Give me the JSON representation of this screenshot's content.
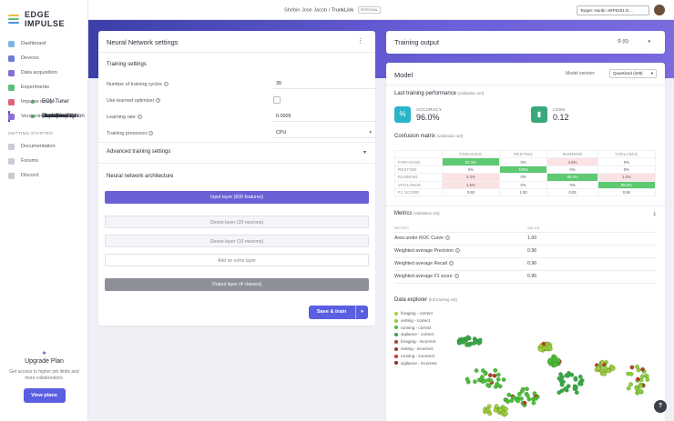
{
  "app": {
    "brand": "EDGE IMPULSE",
    "logo_colors": [
      "#e9c23c",
      "#5fbf7a",
      "#4a8fe2"
    ]
  },
  "header": {
    "user": "Shebin Jose Jacob",
    "separator": "/",
    "project": "TrunkLink",
    "badge": "PERSONAL",
    "target": "Target: Nordic nRF9151 D…"
  },
  "sidebar": {
    "items": [
      {
        "label": "Dashboard",
        "icon": "dashboard-icon",
        "color": "#7fb6e8"
      },
      {
        "label": "Devices",
        "icon": "devices-icon",
        "color": "#6b7fd6"
      },
      {
        "label": "Data acquisition",
        "icon": "database-icon",
        "color": "#8a6fd6"
      },
      {
        "label": "Experiments",
        "icon": "flask-icon",
        "color": "#5fbf7a"
      },
      {
        "label": "EON Tuner",
        "icon": "tuner-icon",
        "color": "#5fbf7a",
        "sub": true
      },
      {
        "label": "Impulse design",
        "icon": "impulse-icon",
        "color": "#e0637a",
        "chevron": "▾"
      },
      {
        "label": "Create impulse",
        "sub": true
      },
      {
        "label": "Raw data",
        "sub": true
      },
      {
        "label": "Classifier",
        "sub": true,
        "active": true
      },
      {
        "label": "Retrain model",
        "sub": true
      },
      {
        "label": "Live classification",
        "sub": true
      },
      {
        "label": "Model testing",
        "sub": true
      },
      {
        "label": "Deployment",
        "sub": true
      },
      {
        "label": "Versioning",
        "icon": "versioning-icon",
        "color": "#8a6fd6"
      }
    ],
    "section": "GETTING STARTED",
    "getting_started": [
      {
        "label": "Documentation",
        "icon": "book-icon"
      },
      {
        "label": "Forums",
        "icon": "forum-icon"
      },
      {
        "label": "Discord",
        "icon": "discord-icon"
      }
    ],
    "upgrade": {
      "title": "Upgrade Plan",
      "text": "Get access to higher job limits and more collaborators.",
      "button": "View plans"
    }
  },
  "nn": {
    "title": "Neural Network settings",
    "menu": "⋮",
    "training_settings": "Training settings",
    "fields": [
      {
        "label": "Number of training cycles",
        "value": "30",
        "type": "text"
      },
      {
        "label": "Use learned optimizer",
        "value": "",
        "type": "checkbox"
      },
      {
        "label": "Learning rate",
        "value": "0.0005",
        "type": "text"
      },
      {
        "label": "Training processor",
        "value": "CPU",
        "type": "select"
      }
    ],
    "advanced": "Advanced training settings",
    "advanced_chevron": "▾",
    "architecture": "Neural network architecture",
    "layers": {
      "input": "Input layer (600 features)",
      "dense1": "Dense layer (20 neurons)",
      "dense2": "Dense layer (10 neurons)",
      "add": "Add an extra layer",
      "output": "Output layer (4 classes)"
    },
    "train_button": "Save & train",
    "train_dropdown": "▾"
  },
  "training_output": {
    "title": "Training output",
    "jobs": "(0)",
    "dropdown": "▾"
  },
  "model": {
    "title": "Model",
    "version_label": "Model version:",
    "version_value": "Quantized (int8)",
    "last_perf": "Last training performance",
    "last_perf_note": "(validation set)",
    "accuracy": {
      "label": "ACCURACY",
      "value": "96.0%",
      "color": "#28b5c8"
    },
    "loss": {
      "label": "LOSS",
      "value": "0.12",
      "color": "#3aa97a"
    },
    "confusion": {
      "title": "Confusion matrix",
      "note": "(validation set)",
      "columns": [
        "FORAGING",
        "RESTING",
        "RUNNING",
        "VIGILANCE"
      ],
      "rows": [
        {
          "label": "FORAGING",
          "cells": [
            "92.3%",
            "0%",
            "4.6%",
            "0%"
          ]
        },
        {
          "label": "RESTING",
          "cells": [
            "0%",
            "100%",
            "0%",
            "0%"
          ]
        },
        {
          "label": "RUNNING",
          "cells": [
            "3.3%",
            "0%",
            "93.4%",
            "1.3%"
          ]
        },
        {
          "label": "VIGILANCE",
          "cells": [
            "1.5%",
            "0%",
            "0%",
            "98.5%"
          ]
        },
        {
          "label": "F1 SCORE",
          "cells": [
            "0.93",
            "1.00",
            "0.93",
            "0.96"
          ]
        }
      ]
    },
    "metrics": {
      "title": "Metrics",
      "note": "(validation set)",
      "col_metric": "METRIC",
      "col_value": "VALUE",
      "rows": [
        {
          "label": "Area under ROC Curve",
          "value": "1.00"
        },
        {
          "label": "Weighted average Precision",
          "value": "0.96"
        },
        {
          "label": "Weighted average Recall",
          "value": "0.96"
        },
        {
          "label": "Weighted average F1 score",
          "value": "0.96"
        }
      ]
    },
    "explorer": {
      "title": "Data explorer",
      "note": "(full training set)",
      "legend": [
        {
          "label": "foraging - correct",
          "color": "#a6cf3a"
        },
        {
          "label": "resting - correct",
          "color": "#8fcf3a"
        },
        {
          "label": "running - correct",
          "color": "#4cbf3a"
        },
        {
          "label": "vigilance - correct",
          "color": "#36a84a"
        },
        {
          "label": "foraging - incorrect",
          "color": "#b03a2a"
        },
        {
          "label": "resting - incorrect",
          "color": "#a8342a"
        },
        {
          "label": "running - incorrect",
          "color": "#c0392b"
        },
        {
          "label": "vigilance - incorrect",
          "color": "#962d22"
        }
      ]
    }
  },
  "help": "?"
}
